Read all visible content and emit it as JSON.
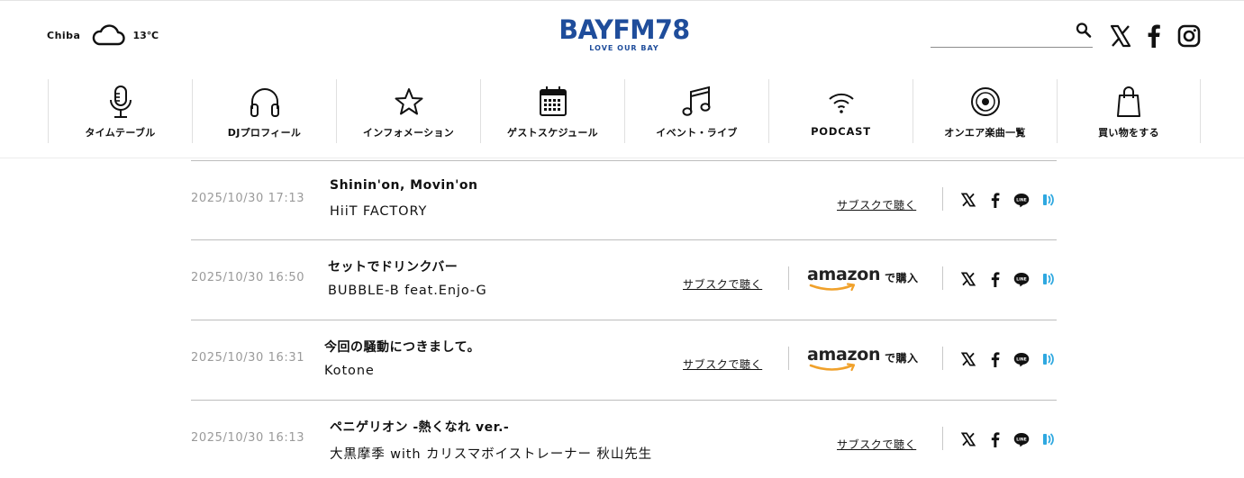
{
  "header": {
    "weather": {
      "city": "Chiba",
      "temp": "13℃",
      "icon": "cloud-icon"
    },
    "logo": {
      "name": "BAYFM78",
      "tagline": "LOVE OUR BAY"
    },
    "search": {
      "placeholder": "",
      "value": ""
    },
    "social": [
      "x-icon",
      "facebook-icon",
      "instagram-icon"
    ]
  },
  "nav": {
    "items": [
      {
        "label": "タイムテーブル",
        "icon": "microphone-icon"
      },
      {
        "label": "DJプロフィール",
        "icon": "headphones-icon"
      },
      {
        "label": "インフォメーション",
        "icon": "star-icon"
      },
      {
        "label": "ゲストスケジュール",
        "icon": "calendar-icon"
      },
      {
        "label": "イベント・ライブ",
        "icon": "music-note-icon"
      },
      {
        "label": "PODCAST",
        "icon": "wifi-signal-icon"
      },
      {
        "label": "オンエア楽曲一覧",
        "icon": "record-disc-icon"
      },
      {
        "label": "買い物をする",
        "icon": "shopping-bag-icon"
      }
    ]
  },
  "colors": {
    "brand": "#1f4d9b",
    "amazon_orange": "#f0a12b",
    "radiko_blue": "#2fa8e0"
  },
  "playlist": {
    "subscribe_label": "サブスクで聴く",
    "amazon_label": "amazon",
    "amazon_buy": "で購入",
    "share_icons": [
      "x-icon",
      "facebook-icon",
      "line-icon",
      "radiko-icon"
    ],
    "line_text": "LINE",
    "rows": [
      {
        "time": "2025/10/30 17:13",
        "title": "Shinin'on, Movin'on",
        "artist": "HiiT FACTORY",
        "has_amazon": false
      },
      {
        "time": "2025/10/30 16:50",
        "title": "セットでドリンクバー",
        "artist": "BUBBLE-B feat.Enjo-G",
        "has_amazon": true
      },
      {
        "time": "2025/10/30 16:31",
        "title": "今回の騒動につきまして。",
        "artist": "Kotone",
        "has_amazon": true
      },
      {
        "time": "2025/10/30 16:13",
        "title": "ペニゲリオン -熱くなれ ver.-",
        "artist": "大黒摩季 with カリスマボイストレーナー 秋山先生",
        "has_amazon": false
      }
    ]
  }
}
